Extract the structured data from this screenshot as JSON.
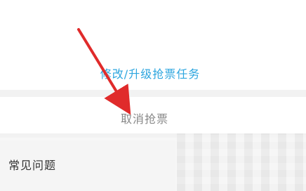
{
  "links": {
    "modify_upgrade": "修改/升级抢票任务"
  },
  "actions": {
    "cancel": "取消抢票"
  },
  "sections": {
    "faq_title": "常见问题"
  },
  "colors": {
    "link_blue": "#2da6df",
    "arrow_red": "#e02b2b",
    "muted_text": "#888888"
  },
  "annotation": {
    "icon": "red-arrow-icon"
  }
}
